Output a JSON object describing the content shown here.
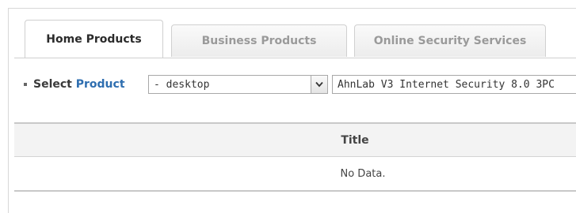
{
  "tabs": [
    {
      "label": "Home Products",
      "active": true
    },
    {
      "label": "Business Products",
      "active": false
    },
    {
      "label": "Online Security Services",
      "active": false
    }
  ],
  "select": {
    "label_prefix": "Select",
    "label_accent": "Product",
    "category_value": "- desktop",
    "product_value": "AhnLab V3 Internet Security 8.0 3PC",
    "arrow_icon": "chevron-down-icon",
    "accent_color": "#2e6eb0"
  },
  "table": {
    "columns": [
      "Title"
    ],
    "empty_message": "No Data."
  }
}
